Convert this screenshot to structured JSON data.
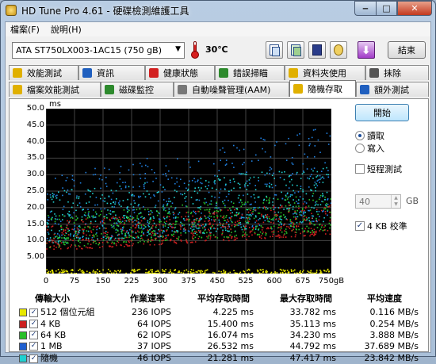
{
  "window": {
    "title": "HD Tune Pro 4.61 - 硬碟檢測維護工具"
  },
  "menu": {
    "items": [
      "檔案(F)",
      "說明(H)"
    ]
  },
  "toolbar": {
    "drive": "ATA    ST750LX003-1AC15 (750 gB)",
    "temperature": "30℃",
    "exit_label": "結束"
  },
  "tabs": {
    "row1": [
      {
        "label": "效能測試",
        "color": "#e0b000"
      },
      {
        "label": "資訊",
        "color": "#1f5fbf"
      },
      {
        "label": "健康狀態",
        "color": "#d22020"
      },
      {
        "label": "錯誤掃瞄",
        "color": "#2d8a2d"
      },
      {
        "label": "資料夾使用",
        "color": "#e0b000"
      },
      {
        "label": "抹除",
        "color": "#555555"
      }
    ],
    "row2": [
      {
        "label": "檔案效能測試",
        "color": "#e0b000"
      },
      {
        "label": "磁碟監控",
        "color": "#2d8a2d"
      },
      {
        "label": "自動噪聲管理(AAM)",
        "color": "#777777"
      },
      {
        "label": "隨機存取",
        "color": "#e0b000"
      },
      {
        "label": "額外測試",
        "color": "#1f5fbf"
      }
    ]
  },
  "controls": {
    "start_label": "開始",
    "read_label": "讀取",
    "write_label": "寫入",
    "short_test_label": "短程測試",
    "short_value": "40",
    "unit_gb": "GB",
    "align_label": "4 KB 校準"
  },
  "chart_data": {
    "type": "scatter",
    "title": "",
    "ylabel": "ms",
    "xlabel": "",
    "y_unit": "ms",
    "x_unit": "gB",
    "ylim": [
      0,
      50
    ],
    "xlim": [
      0,
      750
    ],
    "yticks": [
      "50.0",
      "45.0",
      "40.0",
      "35.0",
      "30.0",
      "25.0",
      "20.0",
      "15.0",
      "10.0",
      "5.00"
    ],
    "xticks": [
      "0",
      "75",
      "150",
      "225",
      "300",
      "375",
      "450",
      "525",
      "600",
      "675",
      "750gB"
    ],
    "series": [
      {
        "name": "512 個位元組",
        "color": "#e8e800",
        "band": [
          0.2,
          1.5
        ]
      },
      {
        "name": "4 KB",
        "color": "#cc2020",
        "band_start": [
          7,
          16
        ],
        "band_end": [
          12,
          22
        ]
      },
      {
        "name": "64 KB",
        "color": "#28c028",
        "band_start": [
          8,
          18
        ],
        "band_end": [
          13,
          25
        ]
      },
      {
        "name": "1 MB",
        "color": "#2080e0",
        "band_start": [
          10,
          30
        ],
        "band_end": [
          16,
          45
        ]
      },
      {
        "name": "隨機",
        "color": "#20d0d0",
        "band_start": [
          9,
          25
        ],
        "band_end": [
          15,
          33
        ]
      }
    ],
    "grid": true,
    "background": "#000000"
  },
  "results": {
    "headers": [
      "傳輸大小",
      "作業速率",
      "平均存取時間",
      "最大存取時間",
      "平均速度"
    ],
    "rows": [
      {
        "label": "512 個位元組",
        "color": "#e8e800",
        "rate": "236 IOPS",
        "avg": "4.225 ms",
        "max": "33.782 ms",
        "speed": "0.116 MB/s"
      },
      {
        "label": "4 KB",
        "color": "#cc2020",
        "rate": "64 IOPS",
        "avg": "15.400 ms",
        "max": "35.113 ms",
        "speed": "0.254 MB/s"
      },
      {
        "label": "64 KB",
        "color": "#28c028",
        "rate": "62 IOPS",
        "avg": "16.074 ms",
        "max": "34.230 ms",
        "speed": "3.888 MB/s"
      },
      {
        "label": "1 MB",
        "color": "#2060d0",
        "rate": "37 IOPS",
        "avg": "26.532 ms",
        "max": "44.792 ms",
        "speed": "37.689 MB/s"
      },
      {
        "label": "隨機",
        "color": "#20d0d0",
        "rate": "46 IOPS",
        "avg": "21.281 ms",
        "max": "47.417 ms",
        "speed": "23.842 MB/s"
      }
    ]
  }
}
